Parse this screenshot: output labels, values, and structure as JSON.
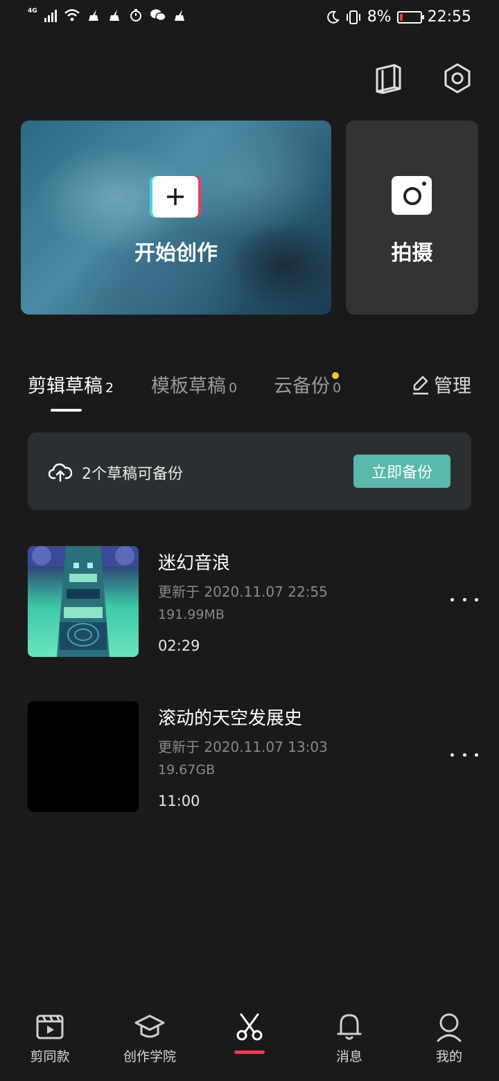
{
  "status_bar": {
    "network": "4G",
    "battery": "8%",
    "time": "22:55"
  },
  "header": {
    "icons": [
      "manual-icon",
      "settings-icon"
    ]
  },
  "actions": {
    "create_label": "开始创作",
    "shoot_label": "拍摄"
  },
  "tabs": [
    {
      "label": "剪辑草稿",
      "count": "2"
    },
    {
      "label": "模板草稿",
      "count": "0"
    },
    {
      "label": "云备份",
      "count": "0"
    }
  ],
  "manage_label": "管理",
  "backup": {
    "text": "2个草稿可备份",
    "button": "立即备份"
  },
  "drafts": [
    {
      "title": "迷幻音浪",
      "updated": "更新于 2020.11.07 22:55",
      "size": "191.99MB",
      "duration": "02:29"
    },
    {
      "title": "滚动的天空发展史",
      "updated": "更新于 2020.11.07 13:03",
      "size": "19.67GB",
      "duration": "11:00"
    }
  ],
  "nav": [
    {
      "label": "剪同款"
    },
    {
      "label": "创作学院"
    },
    {
      "label": ""
    },
    {
      "label": "消息"
    },
    {
      "label": "我的"
    }
  ],
  "colors": {
    "accent": "#ef3b5a",
    "backup_button": "#58b8aa",
    "notify_dot": "#f7c531"
  }
}
